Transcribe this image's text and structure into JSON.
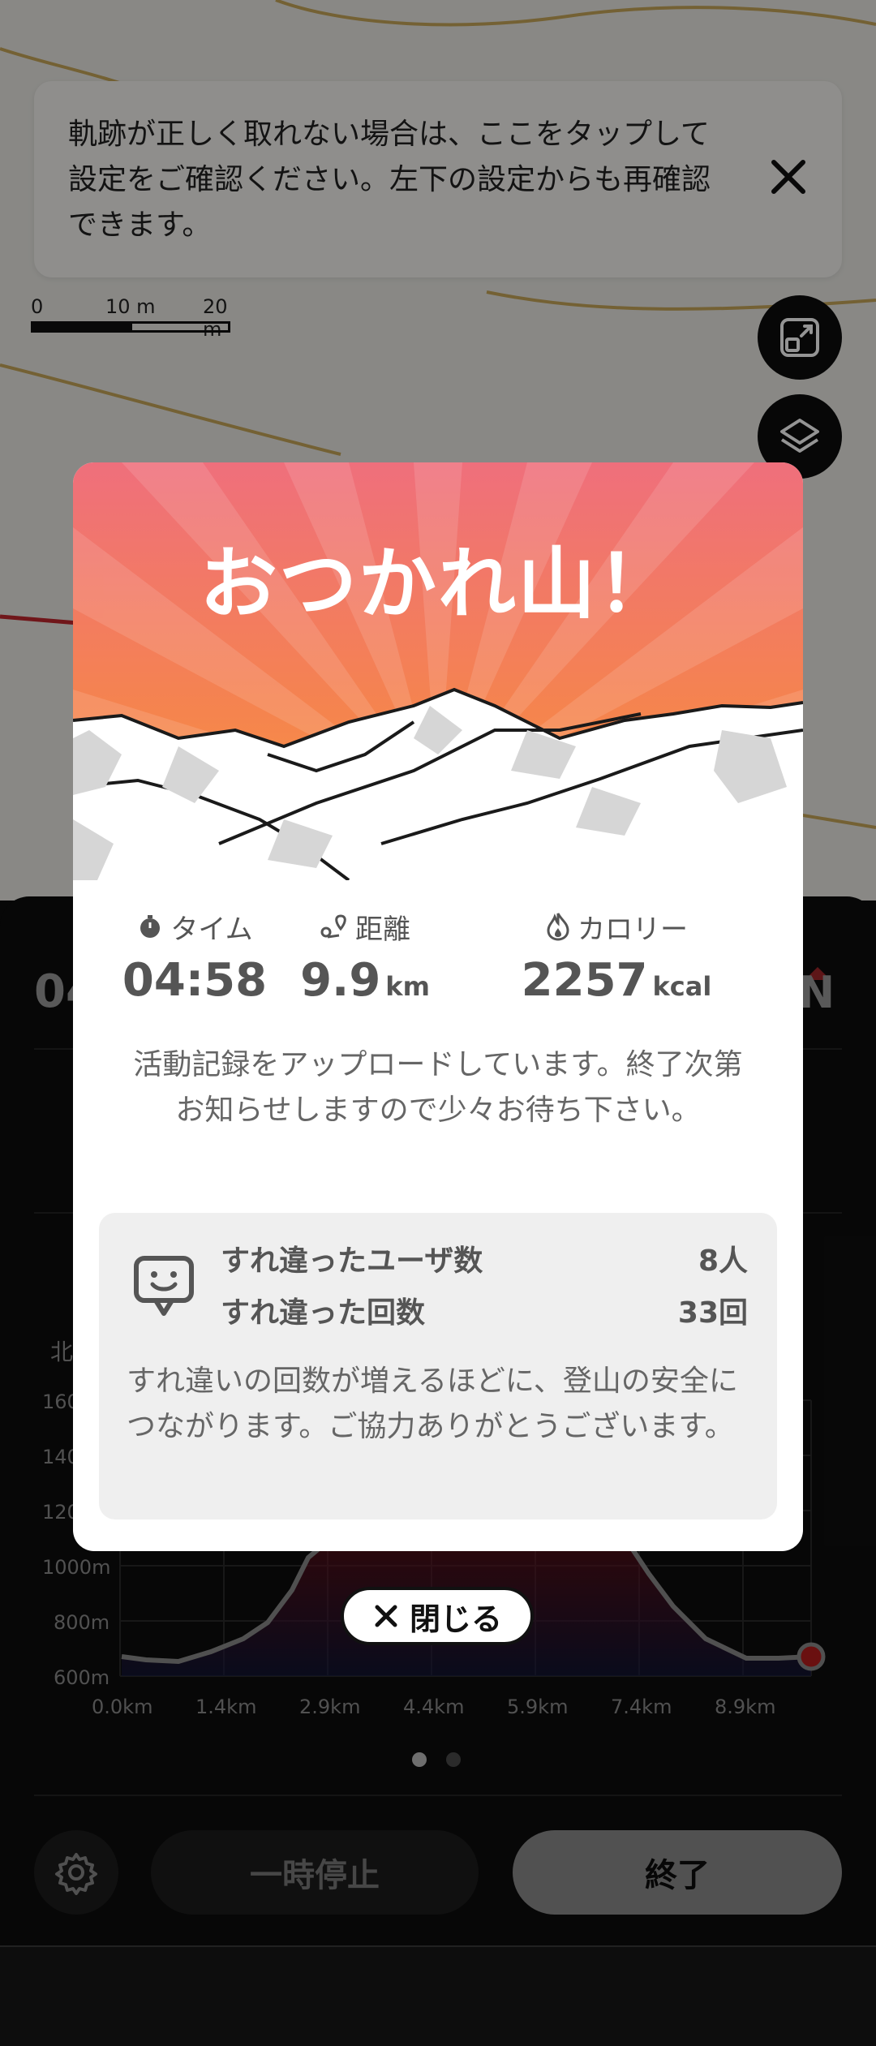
{
  "notice": {
    "text": "軌跡が正しく取れない場合は、ここをタップして設定をご確認ください。左下の設定からも再確認できます。",
    "close_icon": "close-icon"
  },
  "scale": {
    "labels": [
      "0",
      "10 m",
      "20 m"
    ]
  },
  "map_buttons": {
    "expand_icon": "expand-icon",
    "layers_icon": "layers-icon"
  },
  "sheet": {
    "time_partial": "04",
    "compass": "N",
    "elevation_chart": {
      "y_ticks_partial": [
        "北",
        "160",
        "140",
        "120"
      ],
      "y_ticks": [
        "1000m",
        "800m",
        "600m"
      ],
      "x_ticks": [
        "0.0km",
        "1.4km",
        "2.9km",
        "4.4km",
        "5.9km",
        "7.4km",
        "8.9km"
      ]
    },
    "page_dots": 2,
    "gear_icon": "gear-icon",
    "pause_label": "一時停止",
    "end_label": "終了"
  },
  "modal": {
    "title": "おつかれ山！",
    "stats": [
      {
        "icon": "timer-icon",
        "label": "タイム",
        "value": "04:58",
        "unit": ""
      },
      {
        "icon": "route-icon",
        "label": "距離",
        "value": "9.9",
        "unit": "km"
      },
      {
        "icon": "flame-icon",
        "label": "カロリー",
        "value": "2257",
        "unit": "kcal"
      }
    ],
    "upload_message": "活動記録をアップロードしています。終了次第お知らせしますので少々お待ち下さい。",
    "pass": {
      "icon": "pass-device-icon",
      "users_label": "すれ違ったユーザ数",
      "users_value": "8人",
      "count_label": "すれ違った回数",
      "count_value": "33回",
      "note": "すれ違いの回数が増えるほどに、登山の安全につながります。ご協力ありがとうございます。"
    }
  },
  "close_button": {
    "label": "閉じる",
    "icon": "close-icon"
  },
  "colors": {
    "hero_top": "#ef6f7c",
    "hero_bottom": "#f99a3c",
    "track_red": "#c1272d",
    "elev_dot": "#b71c1c"
  }
}
